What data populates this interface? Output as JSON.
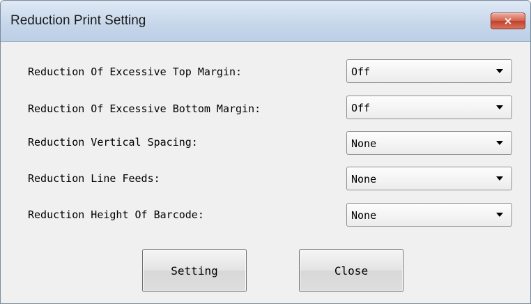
{
  "window": {
    "title": "Reduction Print Setting",
    "close_label": "×"
  },
  "rows": [
    {
      "label": "Reduction Of Excessive Top Margin:",
      "value": "Off"
    },
    {
      "label": "Reduction Of Excessive Bottom Margin:",
      "value": "Off"
    },
    {
      "label": "Reduction Vertical Spacing:",
      "value": "None"
    },
    {
      "label": "Reduction Line Feeds:",
      "value": "None"
    },
    {
      "label": "Reduction Height Of Barcode:",
      "value": "None"
    }
  ],
  "buttons": {
    "setting_label": "Setting",
    "close_label": "Close"
  },
  "icons": {
    "dropdown": "chevron-down-icon",
    "close": "close-icon"
  },
  "colors": {
    "titlebar": "#c6d6ea",
    "close_button": "#c2412b",
    "dialog_bg": "#f0f0f0"
  }
}
